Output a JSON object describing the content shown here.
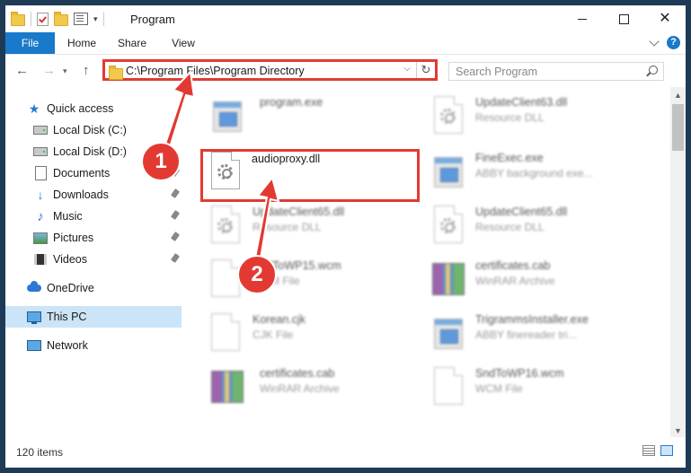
{
  "window": {
    "title": "Program",
    "minimize_icon": "minimize-icon",
    "maximize_icon": "maximize-icon",
    "close_symbol": "✕"
  },
  "ribbon": {
    "tabs": [
      {
        "label": "File"
      },
      {
        "label": "Home"
      },
      {
        "label": "Share"
      },
      {
        "label": "View"
      }
    ],
    "help_symbol": "?"
  },
  "navigation": {
    "back_symbol": "←",
    "forward_symbol": "→",
    "recent_symbol": "▾",
    "up_symbol": "↑"
  },
  "address_bar": {
    "path": "C:\\Program Files\\Program Directory",
    "dropdown_symbol": "⌵",
    "refresh_symbol": "↻"
  },
  "search": {
    "placeholder": "Search Program"
  },
  "sidebar": {
    "items": [
      {
        "label": "Quick access",
        "icon": "star-icon"
      },
      {
        "label": "Local Disk (C:)",
        "icon": "drive-icon",
        "pinned": true
      },
      {
        "label": "Local Disk (D:)",
        "icon": "drive-icon",
        "pinned": true
      },
      {
        "label": "Documents",
        "icon": "documents-icon",
        "pinned": true
      },
      {
        "label": "Downloads",
        "icon": "downloads-icon",
        "pinned": true
      },
      {
        "label": "Music",
        "icon": "music-icon",
        "pinned": true
      },
      {
        "label": "Pictures",
        "icon": "pictures-icon",
        "pinned": true
      },
      {
        "label": "Videos",
        "icon": "videos-icon",
        "pinned": true
      },
      {
        "label": "OneDrive",
        "icon": "onedrive-icon"
      },
      {
        "label": "This PC",
        "icon": "this-pc-icon",
        "selected": true
      },
      {
        "label": "Network",
        "icon": "network-icon"
      }
    ]
  },
  "files": [
    {
      "name": "program.exe",
      "type": "",
      "icon": "exe-icon",
      "blurred": true
    },
    {
      "name": "UpdateClient63.dll",
      "type": "Resource DLL",
      "icon": "dll-icon",
      "blurred": true
    },
    {
      "name": "audioproxy.dll",
      "type": "",
      "icon": "dll-icon",
      "blurred": false
    },
    {
      "name": "FineExec.exe",
      "type": "ABBY background exe...",
      "icon": "exe-icon",
      "blurred": true
    },
    {
      "name": "UpdateClient65.dll",
      "type": "Resource DLL",
      "icon": "dll-icon",
      "blurred": true
    },
    {
      "name": "UpdateClient65.dll",
      "type": "Resource DLL",
      "icon": "dll-icon",
      "blurred": true
    },
    {
      "name": "SndToWP15.wcm",
      "type": "WCM File",
      "icon": "file-icon",
      "blurred": true
    },
    {
      "name": "certificates.cab",
      "type": "WinRAR Archive",
      "icon": "rar-icon",
      "blurred": true
    },
    {
      "name": "Korean.cjk",
      "type": "CJK File",
      "icon": "file-icon",
      "blurred": true
    },
    {
      "name": "TrigrammsInstaller.exe",
      "type": "ABBY finereader tri...",
      "icon": "exe-icon",
      "blurred": true
    },
    {
      "name": "certificates.cab",
      "type": "WinRAR Archive",
      "icon": "rar-icon",
      "blurred": true
    },
    {
      "name": "SndToWP16.wcm",
      "type": "WCM File",
      "icon": "file-icon",
      "blurred": true
    }
  ],
  "status_bar": {
    "item_count": "120 items"
  },
  "annotations": {
    "step1": "1",
    "step2": "2",
    "highlight_color": "#e23a33"
  },
  "colors": {
    "accent": "#1979ca",
    "selection": "#cce4f7"
  }
}
